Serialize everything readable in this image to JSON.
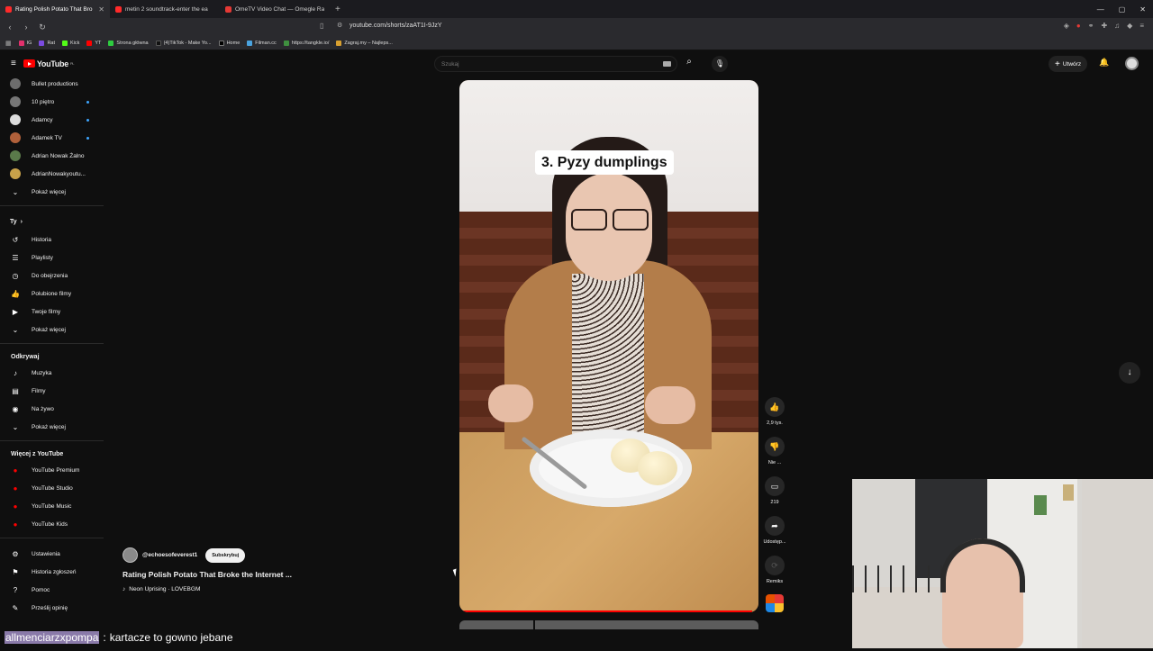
{
  "browser": {
    "tabs": [
      {
        "title": "Rating Polish Potato That Bro",
        "active": true
      },
      {
        "title": "metin 2 soundtrack-enter the ea",
        "active": false
      },
      {
        "title": "OmeTV Video Chat — Omegle Rand",
        "active": false
      }
    ],
    "url": "youtube.com/shorts/zaAT1I-9JzY",
    "bookmarks": [
      "IG",
      "Rat",
      "Kick",
      "YT",
      "Strona główna",
      "(4)TikTok - Make Yo...",
      "Home",
      "Filman.cc",
      "https://tangkle.io/",
      "Zagraj.my – Najleps..."
    ]
  },
  "youtube": {
    "logo_text": "YouTube",
    "logo_region": "PL",
    "search_placeholder": "Szukaj",
    "create_label": "Utwórz",
    "sidebar": {
      "subscriptions": [
        {
          "name": "Bullet productions",
          "color": "#6d6d6d",
          "dot": false
        },
        {
          "name": "10 piętro",
          "color": "#777777",
          "dot": true
        },
        {
          "name": "Adamcy",
          "color": "#dddddd",
          "dot": true
        },
        {
          "name": "Adamek TV",
          "color": "#b0603a",
          "dot": true
        },
        {
          "name": "Adrian Nowak Żalno",
          "color": "#5a7a4a",
          "dot": false
        },
        {
          "name": "AdrianNowakyoutu...",
          "color": "#c8a24a",
          "dot": false
        }
      ],
      "show_more": "Pokaż więcej",
      "you_header": "Ty",
      "you_items": [
        "Historia",
        "Playlisty",
        "Do obejrzenia",
        "Polubione filmy",
        "Twoje filmy",
        "Pokaż więcej"
      ],
      "explore_header": "Odkrywaj",
      "explore_items": [
        "Muzyka",
        "Filmy",
        "Na żywo",
        "Pokaż więcej"
      ],
      "more_header": "Więcej z YouTube",
      "more_items": [
        "YouTube Premium",
        "YouTube Studio",
        "YouTube Music",
        "YouTube Kids"
      ],
      "bottom_items": [
        "Ustawienia",
        "Historia zgłoszeń",
        "Pomoc",
        "Prześlij opinię"
      ]
    },
    "short": {
      "caption": "3. Pyzy dumplings",
      "progress_fraction": 0.98
    },
    "actions": {
      "like": "2,9 tys.",
      "dislike": "Nie ...",
      "comments": "219",
      "share": "Udostęp...",
      "remix": "Remiks"
    },
    "meta": {
      "channel": "@echoesofeverest1",
      "subscribe": "Subskrybuj",
      "title": "Rating Polish Potato That Broke the Internet ...",
      "sound": "Neon Uprising · LOVEBGM"
    }
  },
  "stream_chat": {
    "user": "allmenciarzxpompa",
    "separator": ":",
    "message": "kartacze to gowno jebane"
  }
}
